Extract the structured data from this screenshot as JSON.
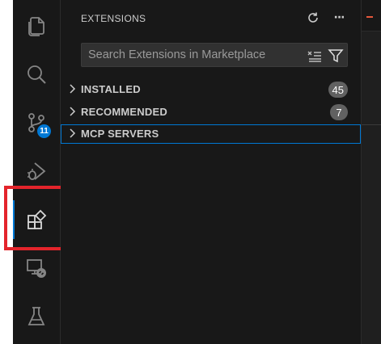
{
  "activity_bar": {
    "items": [
      {
        "icon": "explorer-files-icon"
      },
      {
        "icon": "search-icon"
      },
      {
        "icon": "source-control-icon",
        "badge": "11"
      },
      {
        "icon": "run-and-debug-icon"
      },
      {
        "icon": "extensions-icon",
        "active": true
      },
      {
        "icon": "remote-explorer-icon"
      },
      {
        "icon": "testing-beaker-icon"
      }
    ]
  },
  "sidebar": {
    "title": "EXTENSIONS",
    "actions": [
      {
        "icon": "refresh-icon"
      },
      {
        "icon": "more-actions-icon",
        "label": "···"
      }
    ],
    "search": {
      "placeholder": "Search Extensions in Marketplace",
      "value": "",
      "clear_icon": "clear-filter-icon",
      "filter_icon": "filter-icon"
    },
    "sections": [
      {
        "label": "INSTALLED",
        "count": "45",
        "expanded": false
      },
      {
        "label": "RECOMMENDED",
        "count": "7",
        "expanded": false
      },
      {
        "label": "MCP SERVERS",
        "count": "",
        "expanded": false,
        "focused": true
      }
    ]
  },
  "colors": {
    "background": "#181818",
    "accent": "#0078d4",
    "highlight_box": "#e3242b",
    "text": "#cccccc",
    "count_badge": "#616161"
  }
}
